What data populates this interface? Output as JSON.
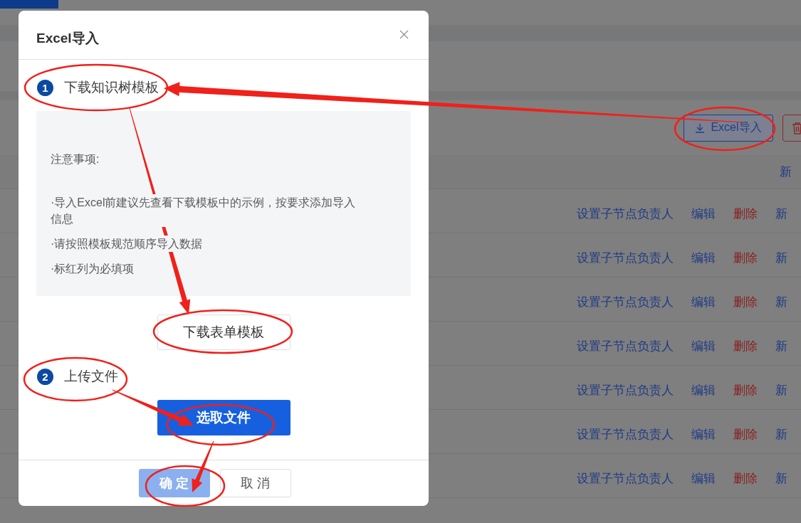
{
  "page": {
    "toolbar": {
      "import_button": "Excel导入"
    },
    "header_action": "新",
    "rows": [
      {
        "actions": [
          {
            "label": "设置子节点负责人",
            "kind": "link"
          },
          {
            "label": "编辑",
            "kind": "link"
          },
          {
            "label": "删除",
            "kind": "danger"
          },
          {
            "label": "新",
            "kind": "link"
          }
        ]
      },
      {
        "actions": [
          {
            "label": "设置子节点负责人",
            "kind": "link"
          },
          {
            "label": "编辑",
            "kind": "link"
          },
          {
            "label": "删除",
            "kind": "danger"
          },
          {
            "label": "新",
            "kind": "link"
          }
        ]
      },
      {
        "actions": [
          {
            "label": "设置子节点负责人",
            "kind": "link"
          },
          {
            "label": "编辑",
            "kind": "link"
          },
          {
            "label": "删除",
            "kind": "danger"
          },
          {
            "label": "新",
            "kind": "link"
          }
        ]
      },
      {
        "actions": [
          {
            "label": "设置子节点负责人",
            "kind": "link"
          },
          {
            "label": "编辑",
            "kind": "link"
          },
          {
            "label": "删除",
            "kind": "danger"
          },
          {
            "label": "新",
            "kind": "link"
          }
        ]
      },
      {
        "actions": [
          {
            "label": "设置子节点负责人",
            "kind": "link"
          },
          {
            "label": "编辑",
            "kind": "link"
          },
          {
            "label": "删除",
            "kind": "danger"
          },
          {
            "label": "新",
            "kind": "link"
          }
        ]
      },
      {
        "actions": [
          {
            "label": "设置子节点负责人",
            "kind": "link"
          },
          {
            "label": "编辑",
            "kind": "link"
          },
          {
            "label": "删除",
            "kind": "danger"
          },
          {
            "label": "新",
            "kind": "link"
          }
        ]
      },
      {
        "actions": [
          {
            "label": "设置子节点负责人",
            "kind": "link"
          },
          {
            "label": "编辑",
            "kind": "link"
          },
          {
            "label": "删除",
            "kind": "danger"
          },
          {
            "label": "新",
            "kind": "link"
          }
        ]
      }
    ]
  },
  "dialog": {
    "title": "Excel导入",
    "step_1": {
      "number": "1",
      "label": "下载知识树模板"
    },
    "notes": {
      "heading": "注意事项:",
      "items": [
        "·导入Excel前建议先查看下载模板中的示例，按要求添加导入信息",
        "·请按照模板规范顺序导入数据",
        "·标红列为必填项"
      ]
    },
    "download_button": "下载表单模板",
    "step_2": {
      "number": "2",
      "label": "上传文件"
    },
    "select_button": "选取文件",
    "footer_buttons": [
      {
        "label": "确 定",
        "kind": "primary",
        "disabled": true
      },
      {
        "label": "取 消",
        "kind": "default",
        "disabled": false
      }
    ]
  }
}
